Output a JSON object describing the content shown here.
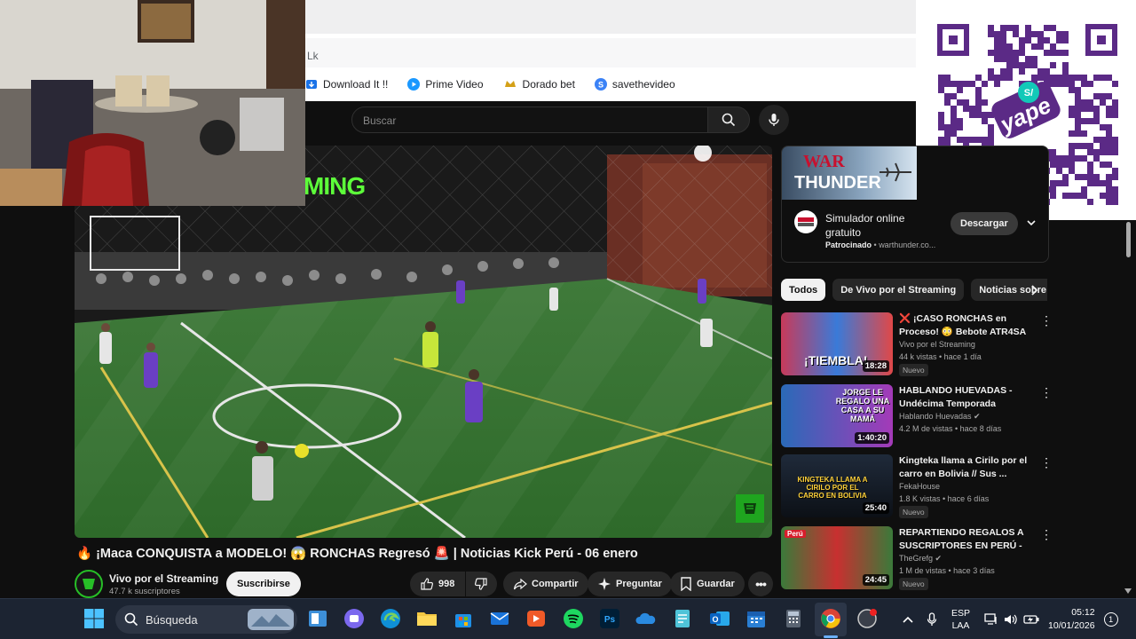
{
  "browser": {
    "url_partial": "Lk",
    "bookmarks": [
      {
        "label": "Download It !!",
        "icon": "download-icon",
        "color": "#1a73e8"
      },
      {
        "label": "Prime Video",
        "icon": "prime-video-icon",
        "color": "#1a98ff"
      },
      {
        "label": "Dorado bet",
        "icon": "dorado-bet-icon",
        "color": "#d4a017"
      },
      {
        "label": "savethevideo",
        "icon": "savethevideo-icon",
        "color": "#3b82f6"
      }
    ]
  },
  "youtube": {
    "search_placeholder": "Buscar",
    "video": {
      "overlay_text": "MING",
      "title": "🔥 ¡Maca CONQUISTA a MODELO! 😱 RONCHAS Regresó 🚨 | Noticias Kick Perú - 06 enero",
      "channel": "Vivo por el Streaming",
      "subscribers": "47.7 k suscriptores",
      "subscribe_label": "Suscribirse",
      "likes": "998",
      "share_label": "Compartir",
      "ask_label": "Preguntar",
      "save_label": "Guardar"
    },
    "ad": {
      "brand_line1": "WAR",
      "brand_line2": "THUNDER",
      "title": "Simulador online gratuito",
      "sponsored": "Patrocinado",
      "domain": "warthunder.co...",
      "cta": "Descargar"
    },
    "chips": [
      "Todos",
      "De Vivo por el Streaming",
      "Noticias sobre"
    ],
    "recommendations": [
      {
        "title": "❌ ¡CASO RONCHAS en Proceso! 😳 Bebote ATR4SA ...",
        "channel": "Vivo por el Streaming",
        "meta": "44 k vistas • hace 1 día",
        "duration": "18:28",
        "badge": "Nuevo",
        "thumb_text": "¡TIEMBLA!"
      },
      {
        "title": "HABLANDO HUEVADAS - Undécima Temporada [JORGE ...",
        "channel": "Hablando Huevadas ✔",
        "meta": "4.2 M de vistas • hace 8 días",
        "duration": "1:40:20",
        "badge": "",
        "thumb_text": "JORGE LE REGALO UNA CASA A SU MAMÁ"
      },
      {
        "title": "Kingteka llama a Cirilo por el carro en Bolivia // Sus ...",
        "channel": "FekaHouse",
        "meta": "1.8 K vistas • hace 6 días",
        "duration": "25:40",
        "badge": "Nuevo",
        "thumb_text": "KINGTEKA LLAMA A CIRILO POR EL CARRO EN BOLIVIA"
      },
      {
        "title": "REPARTIENDO REGALOS A SUSCRIPTORES EN PERÚ - ...",
        "channel": "TheGrefg ✔",
        "meta": "1 M de vistas • hace 3 días",
        "duration": "24:45",
        "badge": "Nuevo",
        "thumb_text": "Perú"
      }
    ]
  },
  "overlay": {
    "qr_brand": "yape",
    "qr_symbol": "S/"
  },
  "taskbar": {
    "search_label": "Búsqueda",
    "language_line1": "ESP",
    "language_line2": "LAA",
    "time": "05:12",
    "date": "10/01/2026",
    "notification_count": "1"
  }
}
